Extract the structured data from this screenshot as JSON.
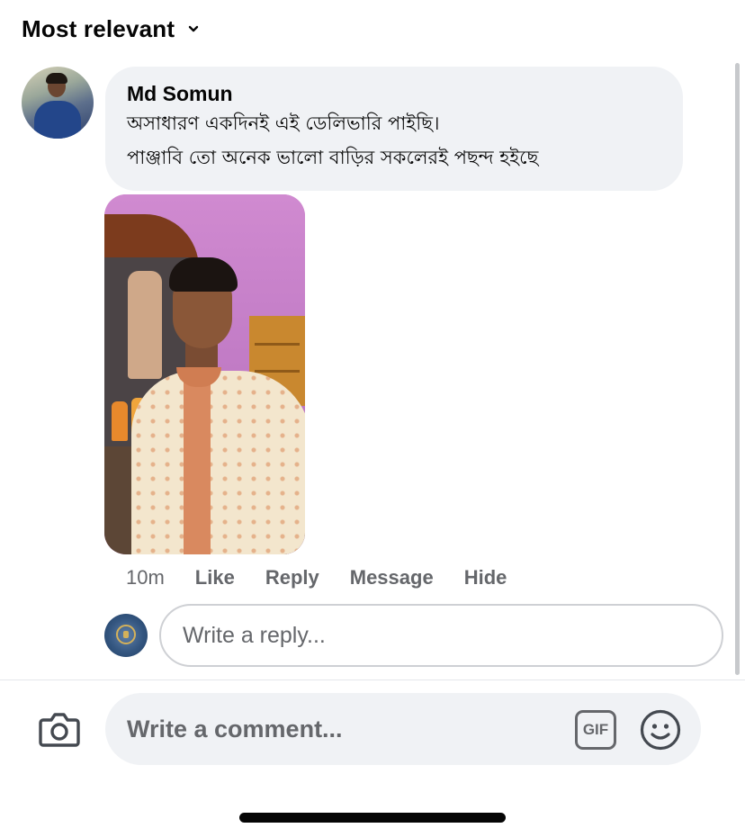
{
  "sort": {
    "label": "Most relevant",
    "icon": "chevron-down-icon"
  },
  "comment": {
    "author": "Md Somun",
    "lines": [
      "অসাধারণ একদিনই এই ডেলিভারি পাইছি।",
      "পাঞ্জাবি তো অনেক ভালো বাড়ির সকলেরই  পছন্দ হইছে"
    ],
    "time": "10m",
    "actions": {
      "like": "Like",
      "reply": "Reply",
      "message": "Message",
      "hide": "Hide"
    }
  },
  "reply": {
    "placeholder": "Write a reply..."
  },
  "composer": {
    "placeholder": "Write a comment...",
    "gif_label": "GIF",
    "camera_icon": "camera-icon",
    "emoji_icon": "smiley-icon"
  },
  "colors": {
    "bubble": "#f0f2f5",
    "secondary_text": "#65676b",
    "primary_text": "#050505"
  }
}
